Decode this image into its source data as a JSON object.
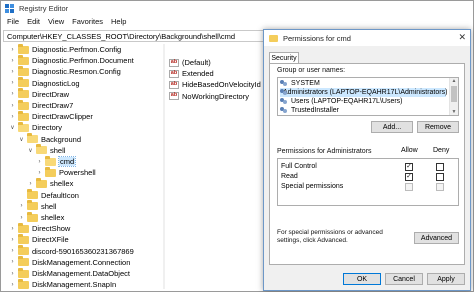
{
  "regedit": {
    "title": "Registry Editor",
    "menu": [
      "File",
      "Edit",
      "View",
      "Favorites",
      "Help"
    ],
    "address": "Computer\\HKEY_CLASSES_ROOT\\Directory\\Background\\shell\\cmd",
    "tree": [
      {
        "label": "Diagnostic.Perfmon.Config",
        "level": 2,
        "expander": ">",
        "open": false
      },
      {
        "label": "Diagnostic.Perfmon.Document",
        "level": 2,
        "expander": ">",
        "open": false
      },
      {
        "label": "Diagnostic.Resmon.Config",
        "level": 2,
        "expander": ">",
        "open": false
      },
      {
        "label": "DiagnosticLog",
        "level": 2,
        "expander": ">",
        "open": false
      },
      {
        "label": "DirectDraw",
        "level": 2,
        "expander": ">",
        "open": false
      },
      {
        "label": "DirectDraw7",
        "level": 2,
        "expander": ">",
        "open": false
      },
      {
        "label": "DirectDrawClipper",
        "level": 2,
        "expander": ">",
        "open": false
      },
      {
        "label": "Directory",
        "level": 2,
        "expander": "v",
        "open": true
      },
      {
        "label": "Background",
        "level": 3,
        "expander": "v",
        "open": true
      },
      {
        "label": "shell",
        "level": 4,
        "expander": "v",
        "open": true
      },
      {
        "label": "cmd",
        "level": 5,
        "expander": ">",
        "open": true,
        "selected": true
      },
      {
        "label": "Powershell",
        "level": 5,
        "expander": ">",
        "open": false
      },
      {
        "label": "shellex",
        "level": 4,
        "expander": ">",
        "open": false
      },
      {
        "label": "DefaultIcon",
        "level": 3,
        "expander": "",
        "open": false
      },
      {
        "label": "shell",
        "level": 3,
        "expander": ">",
        "open": false
      },
      {
        "label": "shellex",
        "level": 3,
        "expander": ">",
        "open": false
      },
      {
        "label": "DirectShow",
        "level": 2,
        "expander": ">",
        "open": false
      },
      {
        "label": "DirectXFile",
        "level": 2,
        "expander": ">",
        "open": false
      },
      {
        "label": "discord-590165360231367869",
        "level": 2,
        "expander": ">",
        "open": false
      },
      {
        "label": "DiskManagement.Connection",
        "level": 2,
        "expander": ">",
        "open": false
      },
      {
        "label": "DiskManagement.DataObject",
        "level": 2,
        "expander": ">",
        "open": false
      },
      {
        "label": "DiskManagement.SnapIn",
        "level": 2,
        "expander": ">",
        "open": false
      }
    ],
    "values": [
      "(Default)",
      "Extended",
      "HideBasedOnVelocityId",
      "NoWorkingDirectory"
    ],
    "value_icon": "ab"
  },
  "dialog": {
    "title": "Permissions for cmd",
    "close": "✕",
    "tab": "Security",
    "group_label": "Group or user names:",
    "users": [
      {
        "name": "SYSTEM",
        "selected": false
      },
      {
        "name": "Administrators (LAPTOP-EQAHR17L\\Administrators)",
        "selected": true
      },
      {
        "name": "Users (LAPTOP-EQAHR17L\\Users)",
        "selected": false
      },
      {
        "name": "TrustedInstaller",
        "selected": false
      }
    ],
    "add_label": "Add...",
    "remove_label": "Remove",
    "perm_label": "Permissions for Administrators",
    "allow_label": "Allow",
    "deny_label": "Deny",
    "permissions": [
      {
        "name": "Full Control",
        "allow": true,
        "deny": false,
        "disabled": false
      },
      {
        "name": "Read",
        "allow": true,
        "deny": false,
        "disabled": false
      },
      {
        "name": "Special permissions",
        "allow": false,
        "deny": false,
        "disabled": true
      }
    ],
    "footer_text": "For special permissions or advanced settings, click Advanced.",
    "advanced_label": "Advanced",
    "ok_label": "OK",
    "cancel_label": "Cancel",
    "apply_label": "Apply"
  }
}
